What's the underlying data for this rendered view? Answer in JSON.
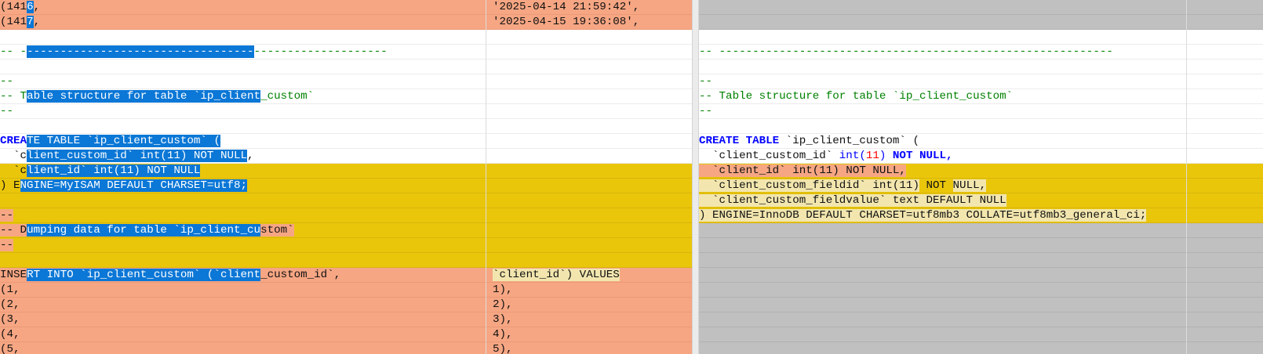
{
  "left": {
    "lines": [
      {
        "state": "added",
        "c1": [
          {
            "t": "(141",
            "k": ""
          },
          {
            "t": "6",
            "k": "sel"
          },
          {
            "t": ",",
            "k": ""
          }
        ],
        "c2": [
          {
            "t": "'2025-04-14 21:59:42',",
            "k": ""
          }
        ]
      },
      {
        "state": "added",
        "c1": [
          {
            "t": "(141",
            "k": ""
          },
          {
            "t": "7",
            "k": "sel"
          },
          {
            "t": ",",
            "k": ""
          }
        ],
        "c2": [
          {
            "t": "'2025-04-15 19:36:08',",
            "k": ""
          }
        ]
      },
      {
        "state": "plain",
        "c1": [],
        "c2": []
      },
      {
        "state": "plain",
        "c1": [
          {
            "t": "-- -",
            "k": "cm"
          },
          {
            "t": "----------------------------------",
            "k": "sel"
          },
          {
            "t": "--------------------",
            "k": "cm"
          }
        ],
        "c2": []
      },
      {
        "state": "plain",
        "c1": [],
        "c2": []
      },
      {
        "state": "plain",
        "c1": [
          {
            "t": "--",
            "k": "cm"
          }
        ],
        "c2": []
      },
      {
        "state": "plain",
        "c1": [
          {
            "t": "-- T",
            "k": "cm"
          },
          {
            "t": "able structure for table `ip_client",
            "k": "sel"
          },
          {
            "t": "_custom`",
            "k": "cm"
          }
        ],
        "c2": []
      },
      {
        "state": "plain",
        "c1": [
          {
            "t": "--",
            "k": "cm"
          }
        ],
        "c2": []
      },
      {
        "state": "plain",
        "c1": [],
        "c2": []
      },
      {
        "state": "plain",
        "c1": [
          {
            "t": "CREA",
            "k": "kw"
          },
          {
            "t": "TE TABLE",
            "k": "sel"
          },
          {
            "t": " `ip_client_custom` (",
            "k": "sel"
          }
        ],
        "c2": []
      },
      {
        "state": "plain",
        "c1": [
          {
            "t": "  `c",
            "k": ""
          },
          {
            "t": "lient_custom_id` int(11) NOT NULL",
            "k": "sel"
          },
          {
            "t": ",",
            "k": ""
          }
        ],
        "c2": []
      },
      {
        "state": "changed",
        "c1": [
          {
            "t": "  `c",
            "k": ""
          },
          {
            "t": "lient_id` int(11) NOT NULL",
            "k": "sel"
          }
        ],
        "c2": []
      },
      {
        "state": "changed",
        "c1": [
          {
            "t": ") E",
            "k": ""
          },
          {
            "t": "NGINE=MyISAM DEFAULT CHARSET=utf8;",
            "k": "sel"
          }
        ],
        "c2": []
      },
      {
        "state": "changed",
        "c1": [],
        "c2": []
      },
      {
        "state": "changed",
        "c1": [
          {
            "t": "--",
            "k": "hl-rose"
          }
        ],
        "c2": []
      },
      {
        "state": "changed",
        "c1": [
          {
            "t": "-- D",
            "k": "hl-rose"
          },
          {
            "t": "umping data for table `ip_client_cu",
            "k": "sel"
          },
          {
            "t": "stom`",
            "k": "hl-rose"
          }
        ],
        "c2": []
      },
      {
        "state": "changed",
        "c1": [
          {
            "t": "--",
            "k": "hl-rose"
          }
        ],
        "c2": []
      },
      {
        "state": "changed",
        "c1": [],
        "c2": []
      },
      {
        "state": "added",
        "c1": [
          {
            "t": "INSE",
            "k": ""
          },
          {
            "t": "RT INTO `ip_client_custom` (`client",
            "k": "sel"
          },
          {
            "t": "_custom_id`,",
            "k": ""
          }
        ],
        "c2": [
          {
            "t": "`client_id`) VALUES",
            "k": "hl-soft"
          }
        ]
      },
      {
        "state": "added",
        "c1": [
          {
            "t": "(1,",
            "k": ""
          }
        ],
        "c2": [
          {
            "t": "1),",
            "k": ""
          }
        ]
      },
      {
        "state": "added",
        "c1": [
          {
            "t": "(2,",
            "k": ""
          }
        ],
        "c2": [
          {
            "t": "2),",
            "k": ""
          }
        ]
      },
      {
        "state": "added",
        "c1": [
          {
            "t": "(3,",
            "k": ""
          }
        ],
        "c2": [
          {
            "t": "3),",
            "k": ""
          }
        ]
      },
      {
        "state": "added",
        "c1": [
          {
            "t": "(4,",
            "k": ""
          }
        ],
        "c2": [
          {
            "t": "4),",
            "k": ""
          }
        ]
      },
      {
        "state": "added",
        "c1": [
          {
            "t": "(5,",
            "k": ""
          }
        ],
        "c2": [
          {
            "t": "5),",
            "k": ""
          }
        ]
      }
    ]
  },
  "right": {
    "lines": [
      {
        "state": "missing",
        "c1": []
      },
      {
        "state": "missing",
        "c1": []
      },
      {
        "state": "plain",
        "c1": []
      },
      {
        "state": "plain",
        "c1": [
          {
            "t": "-- -----------------------------------------------------------",
            "k": "cm"
          }
        ]
      },
      {
        "state": "plain",
        "c1": []
      },
      {
        "state": "plain",
        "c1": [
          {
            "t": "--",
            "k": "cm"
          }
        ]
      },
      {
        "state": "plain",
        "c1": [
          {
            "t": "-- Table structure for table `ip_client_custom`",
            "k": "cm"
          }
        ]
      },
      {
        "state": "plain",
        "c1": [
          {
            "t": "--",
            "k": "cm"
          }
        ]
      },
      {
        "state": "plain",
        "c1": []
      },
      {
        "state": "plain",
        "c1": [
          {
            "t": "CREATE TABLE",
            "k": "kw"
          },
          {
            "t": " `ip_client_custom` (",
            "k": ""
          }
        ]
      },
      {
        "state": "plain",
        "c1": [
          {
            "t": "  `client_custom_id` ",
            "k": ""
          },
          {
            "t": "int(",
            "k": "kw-n"
          },
          {
            "t": "11",
            "k": "num"
          },
          {
            "t": ")",
            "k": "kw-n"
          },
          {
            "t": " ",
            "k": ""
          },
          {
            "t": "NOT NULL,",
            "k": "kw"
          }
        ]
      },
      {
        "state": "changed",
        "c1": [
          {
            "t": "  `client_id` int(11) NOT NULL,",
            "k": "hl-rose"
          }
        ]
      },
      {
        "state": "changed",
        "c1": [
          {
            "t": "  `client_custom_fieldid` int(11)",
            "k": "hl-soft"
          },
          {
            "t": " NOT ",
            "k": ""
          },
          {
            "t": "NULL,",
            "k": "hl-soft"
          }
        ]
      },
      {
        "state": "changed",
        "c1": [
          {
            "t": "  `client_custom_fieldvalue` text DEFAULT NULL",
            "k": "hl-soft"
          }
        ]
      },
      {
        "state": "changed",
        "c1": [
          {
            "t": ") ENGINE=InnoDB DEFAULT CHARSET=utf8mb3 COLLATE=utf8mb3_general_ci;",
            "k": "hl-soft"
          }
        ]
      },
      {
        "state": "missing",
        "c1": []
      },
      {
        "state": "missing",
        "c1": []
      },
      {
        "state": "missing",
        "c1": []
      },
      {
        "state": "missing",
        "c1": []
      },
      {
        "state": "missing",
        "c1": []
      },
      {
        "state": "missing",
        "c1": []
      },
      {
        "state": "missing",
        "c1": []
      },
      {
        "state": "missing",
        "c1": []
      },
      {
        "state": "missing",
        "c1": []
      }
    ]
  }
}
